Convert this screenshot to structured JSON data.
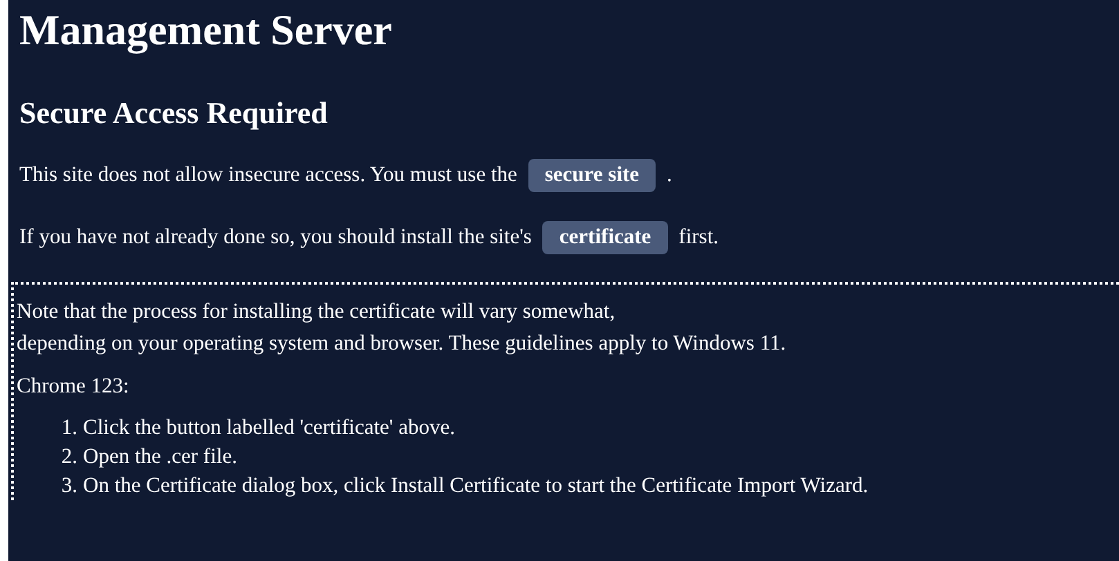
{
  "title": "Management Server",
  "subtitle": "Secure Access Required",
  "paragraphs": [
    {
      "before": "This site does not allow insecure access. You must use the",
      "button": "secure site",
      "after": "."
    },
    {
      "before": "If you have not already done so, you should install the site's",
      "button": "certificate",
      "after": "first."
    }
  ],
  "note": {
    "lines": [
      "Note that the process for installing the certificate will vary somewhat,",
      "depending on your operating system and browser. These guidelines apply to Windows 11."
    ],
    "browser": "Chrome 123:",
    "steps": [
      {
        "number": "1.",
        "text": "Click the button labelled 'certificate' above."
      },
      {
        "number": "2.",
        "text": "Open the .cer file."
      },
      {
        "number": "3.",
        "text": "On the Certificate dialog box, click Install Certificate to start the Certificate Import Wizard."
      }
    ]
  }
}
